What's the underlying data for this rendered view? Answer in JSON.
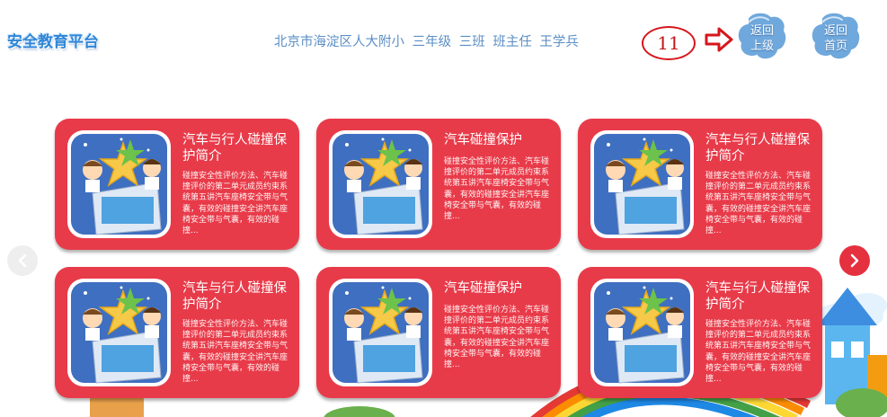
{
  "header": {
    "logo": "安全教育平台",
    "info": "北京市海淀区人大附小  三年级  三班  班主任 王学兵",
    "step_marker": "11",
    "back_button": {
      "line1": "返回",
      "line2": "上级"
    },
    "home_button": {
      "line1": "返回",
      "line2": "首页"
    }
  },
  "cards": [
    {
      "title": "汽车与行人碰撞保护简介",
      "desc": "碰撞安全性评价方法、汽车碰撞评价的第二单元成员约束系统第五讲汽车座椅安全带与气囊，有效的碰撞安全讲汽车座椅安全带与气囊，有效的碰撞..."
    },
    {
      "title": "汽车碰撞保护",
      "desc": "碰撞安全性评价方法、汽车碰撞评价的第二单元成员约束系统第五讲汽车座椅安全带与气囊，有效的碰撞安全讲汽车座椅安全带与气囊，有效的碰撞..."
    },
    {
      "title": "汽车与行人碰撞保护简介",
      "desc": "碰撞安全性评价方法、汽车碰撞评价的第二单元成员约束系统第五讲汽车座椅安全带与气囊，有效的碰撞安全讲汽车座椅安全带与气囊，有效的碰撞..."
    },
    {
      "title": "汽车与行人碰撞保护简介",
      "desc": "碰撞安全性评价方法、汽车碰撞评价的第二单元成员约束系统第五讲汽车座椅安全带与气囊，有效的碰撞安全讲汽车座椅安全带与气囊，有效的碰撞..."
    },
    {
      "title": "汽车碰撞保护",
      "desc": "碰撞安全性评价方法、汽车碰撞评价的第二单元成员约束系统第五讲汽车座椅安全带与气囊，有效的碰撞安全讲汽车座椅安全带与气囊，有效的碰撞..."
    },
    {
      "title": "汽车与行人碰撞保护简介",
      "desc": "碰撞安全性评价方法、汽车碰撞评价的第二单元成员约束系统第五讲汽车座椅安全带与气囊，有效的碰撞安全讲汽车座椅安全带与气囊，有效的碰撞..."
    }
  ],
  "nav": {
    "prev_icon": "chevron-left-icon",
    "next_icon": "chevron-right-icon"
  },
  "colors": {
    "card": "#e83b4a",
    "accent_blue": "#5b8fc6",
    "marker_red": "#d6161b"
  }
}
